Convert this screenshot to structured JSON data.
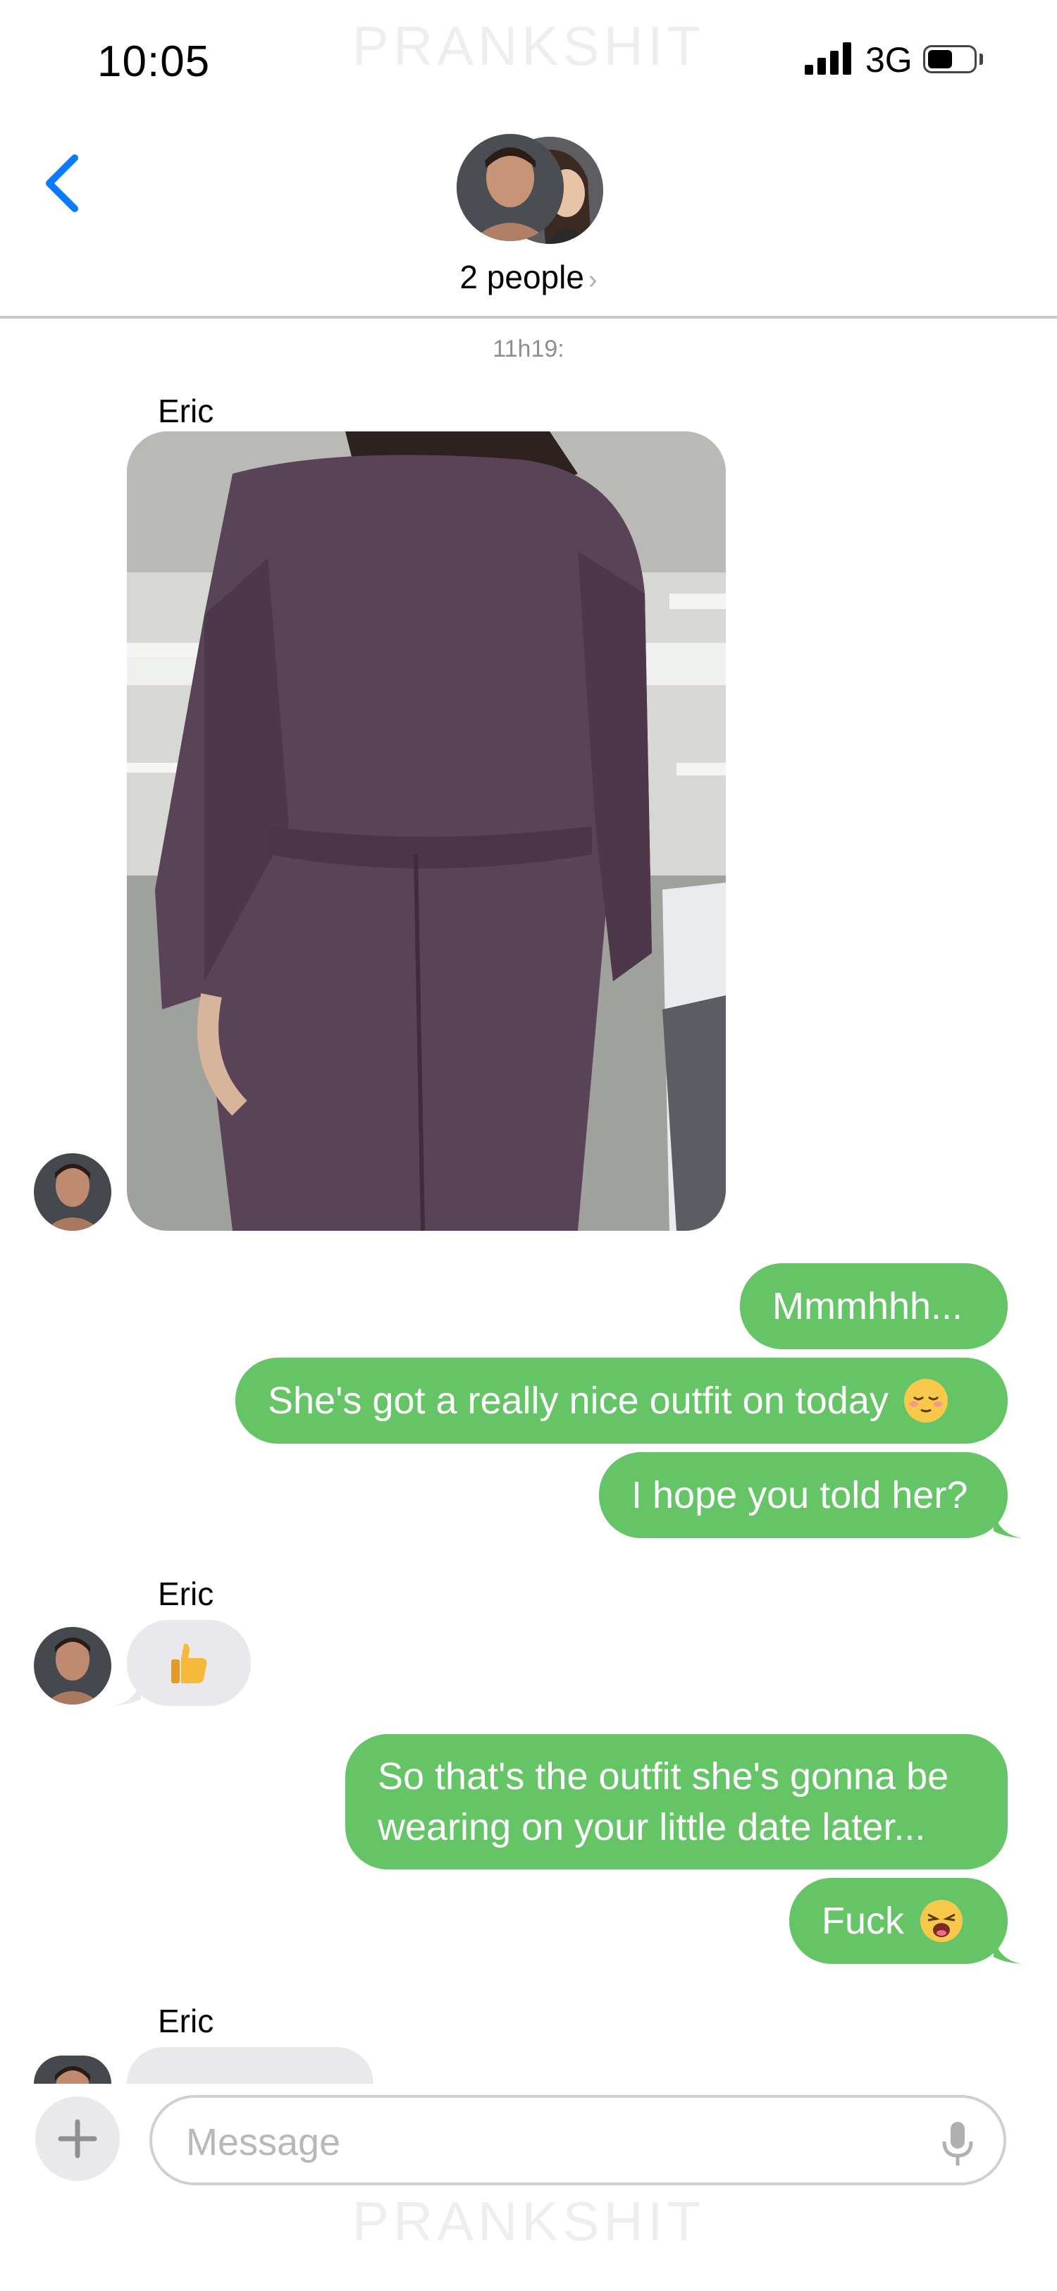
{
  "status_bar": {
    "time": "10:05",
    "network": "3G",
    "watermark": "PRANKSHIT"
  },
  "header": {
    "title": "2 people"
  },
  "thread": {
    "timestamp": "11h19:",
    "sender_1": "Eric",
    "out_1": "Mmmhhh...",
    "out_2": "She's got a really nice outfit on today",
    "out_3": "I hope you told her?",
    "sender_2": "Eric",
    "out_4_line1": "So that's the outfit she's gonna be",
    "out_4_line2": "wearing on your little date later...",
    "out_5": "Fuck",
    "sender_3": "Eric"
  },
  "composer": {
    "placeholder": "Message"
  },
  "footer": {
    "watermark": "PRANKSHIT"
  },
  "colors": {
    "outgoing_bubble": "#65c466",
    "incoming_bubble": "#e9e9eb",
    "accent": "#0a7aff"
  }
}
